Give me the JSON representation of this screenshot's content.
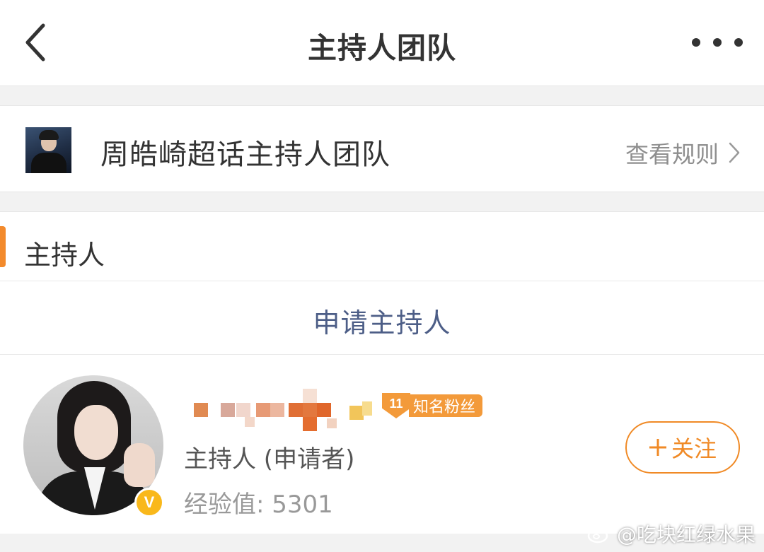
{
  "nav": {
    "title": "主持人团队",
    "back_icon": "chevron-left-icon",
    "more_icon": "more-horizontal-icon"
  },
  "team": {
    "name": "周皓崎超话主持人团队",
    "rules_label": "查看规则",
    "rules_icon": "chevron-right-icon"
  },
  "section": {
    "title": "主持人",
    "accent_color": "#f38a2c",
    "apply_label": "申请主持人"
  },
  "member": {
    "name_hidden": "pixelated",
    "fan_badge_level": "11",
    "fan_badge_label": "知名粉丝",
    "role": "主持人 (申请者)",
    "exp_label": "经验值:",
    "exp_value": "5301",
    "follow_label": "关注",
    "follow_icon": "plus-icon",
    "verified_icon": "verified-v-icon",
    "verified_letter": "V"
  },
  "watermark": {
    "text": "@吃块红绿水果",
    "icon": "weibo-icon"
  },
  "colors": {
    "accent": "#f08a26",
    "link_blue": "#4d5e87",
    "badge": "#f39a3a"
  }
}
